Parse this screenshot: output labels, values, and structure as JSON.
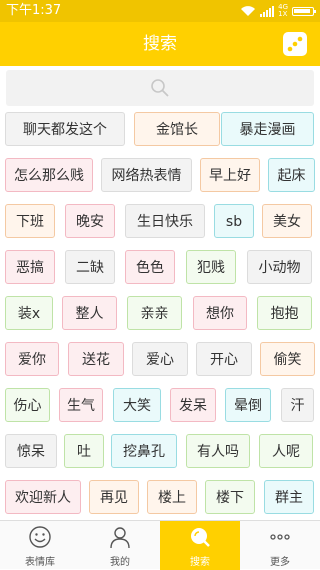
{
  "status": {
    "time": "下午1:37",
    "net_top": "4G",
    "net_bottom": "1X"
  },
  "header": {
    "title": "搜索"
  },
  "tags_rows": [
    [
      "聊天都发这个",
      "金馆长",
      "暴走漫画"
    ],
    [
      "怎么那么贱",
      "网络热表情",
      "早上好",
      "起床"
    ],
    [
      "下班",
      "晚安",
      "生日快乐",
      "sb",
      "美女"
    ],
    [
      "恶搞",
      "二缺",
      "色色",
      "犯贱",
      "小动物"
    ],
    [
      "装x",
      "整人",
      "亲亲",
      "想你",
      "抱抱"
    ],
    [
      "爱你",
      "送花",
      "爱心",
      "开心",
      "偷笑"
    ],
    [
      "伤心",
      "生气",
      "大笑",
      "发呆",
      "晕倒",
      "汗"
    ],
    [
      "惊呆",
      "吐",
      "挖鼻孔",
      "有人吗",
      "人呢"
    ],
    [
      "欢迎新人",
      "再见",
      "楼上",
      "楼下",
      "群主"
    ]
  ],
  "tabs": [
    {
      "label": "表情库",
      "icon": "smiley-icon"
    },
    {
      "label": "我的",
      "icon": "person-icon"
    },
    {
      "label": "搜索",
      "icon": "search-icon"
    },
    {
      "label": "更多",
      "icon": "more-dots-icon"
    }
  ],
  "colors": {
    "accent": "#ffd000",
    "statusbar": "#f0c400"
  }
}
